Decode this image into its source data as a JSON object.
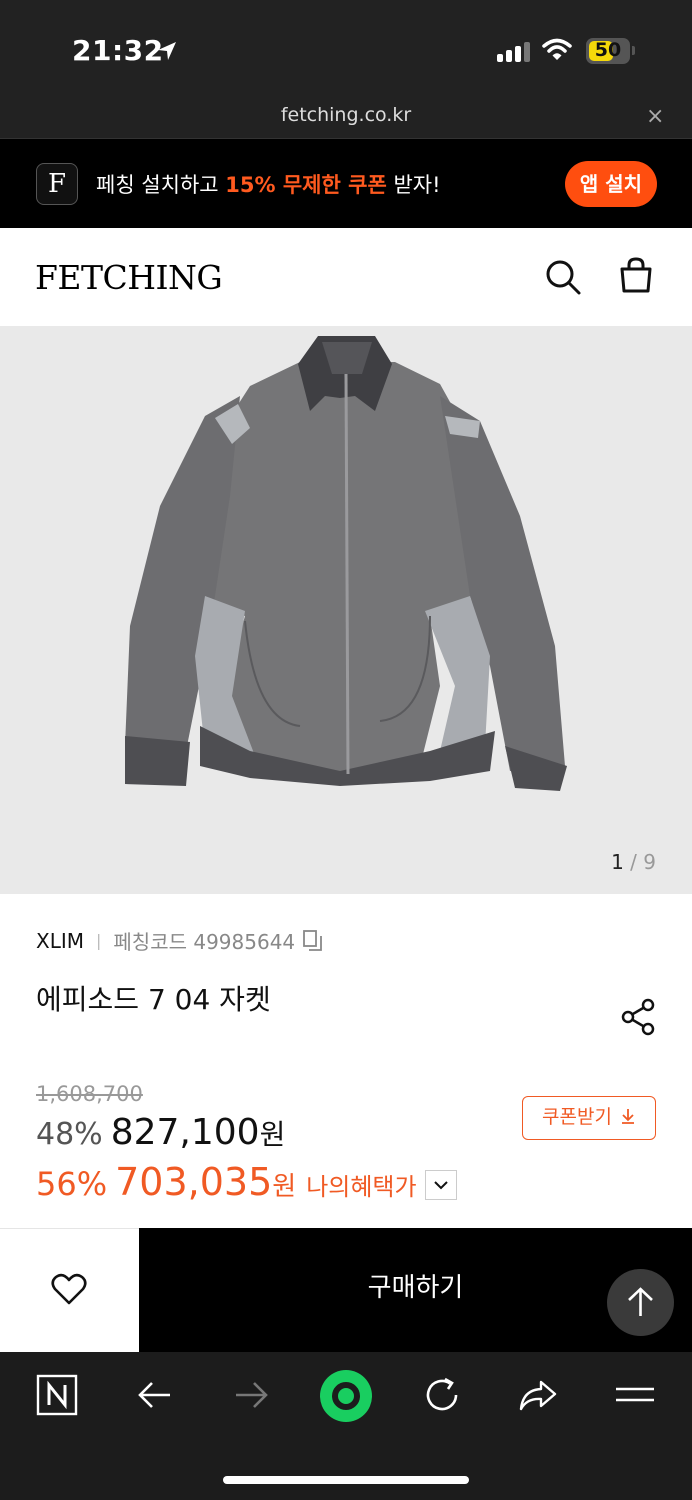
{
  "status": {
    "time": "21:32",
    "battery": "50"
  },
  "browser": {
    "url": "fetching.co.kr",
    "close_glyph": "×"
  },
  "banner": {
    "app_icon_letter": "F",
    "text_pre": "페칭 설치하고 ",
    "text_highlight": "15% 무제한 쿠폰",
    "text_post": " 받자!",
    "install_label": "앱 설치",
    "accent_color": "#ff4e0f"
  },
  "header": {
    "logo": "FETCHING",
    "search_icon": "search-icon",
    "bag_icon": "bag-icon"
  },
  "gallery": {
    "current": "1",
    "divider": " / ",
    "total": "9"
  },
  "product": {
    "brand": "XLIM",
    "code_label": "페칭코드 49985644",
    "title": "에피소드 7 04 자켓",
    "original_price": "1,608,700",
    "discount_pct": "48%",
    "price": "827,100",
    "currency": "원",
    "benefit_pct": "56%",
    "benefit_price": "703,035",
    "benefit_currency": "원",
    "benefit_label": "나의혜택가",
    "coupon_label": "쿠폰받기",
    "price_color": "#f05a24"
  },
  "actions": {
    "buy_label": "구매하기"
  }
}
